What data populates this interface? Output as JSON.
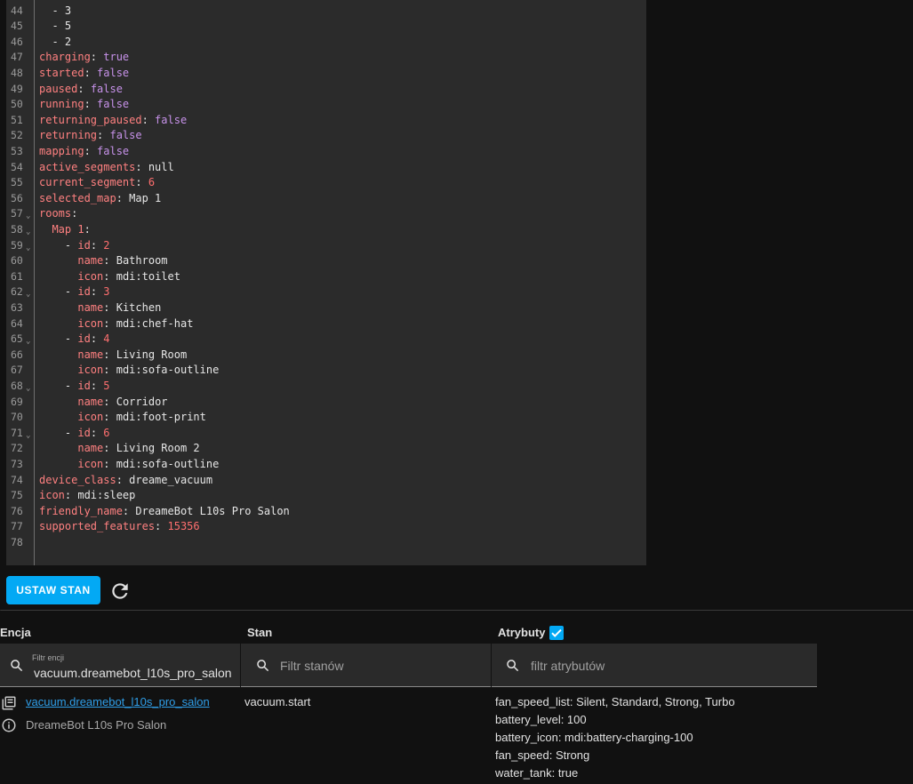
{
  "editor": {
    "lines": [
      {
        "n": "44",
        "fold": false,
        "indent": "  ",
        "parts": [
          {
            "t": "- ",
            "c": "p"
          },
          {
            "t": "3",
            "c": "s"
          }
        ]
      },
      {
        "n": "45",
        "fold": false,
        "indent": "  ",
        "parts": [
          {
            "t": "- ",
            "c": "p"
          },
          {
            "t": "5",
            "c": "s"
          }
        ]
      },
      {
        "n": "46",
        "fold": false,
        "indent": "  ",
        "parts": [
          {
            "t": "- ",
            "c": "p"
          },
          {
            "t": "2",
            "c": "s"
          }
        ]
      },
      {
        "n": "47",
        "fold": false,
        "indent": "",
        "parts": [
          {
            "t": "charging",
            "c": "k"
          },
          {
            "t": ": ",
            "c": "p"
          },
          {
            "t": "true",
            "c": "b"
          }
        ]
      },
      {
        "n": "48",
        "fold": false,
        "indent": "",
        "parts": [
          {
            "t": "started",
            "c": "k"
          },
          {
            "t": ": ",
            "c": "p"
          },
          {
            "t": "false",
            "c": "b"
          }
        ]
      },
      {
        "n": "49",
        "fold": false,
        "indent": "",
        "parts": [
          {
            "t": "paused",
            "c": "k"
          },
          {
            "t": ": ",
            "c": "p"
          },
          {
            "t": "false",
            "c": "b"
          }
        ]
      },
      {
        "n": "50",
        "fold": false,
        "indent": "",
        "parts": [
          {
            "t": "running",
            "c": "k"
          },
          {
            "t": ": ",
            "c": "p"
          },
          {
            "t": "false",
            "c": "b"
          }
        ]
      },
      {
        "n": "51",
        "fold": false,
        "indent": "",
        "parts": [
          {
            "t": "returning_paused",
            "c": "k"
          },
          {
            "t": ": ",
            "c": "p"
          },
          {
            "t": "false",
            "c": "b"
          }
        ]
      },
      {
        "n": "52",
        "fold": false,
        "indent": "",
        "parts": [
          {
            "t": "returning",
            "c": "k"
          },
          {
            "t": ": ",
            "c": "p"
          },
          {
            "t": "false",
            "c": "b"
          }
        ]
      },
      {
        "n": "53",
        "fold": false,
        "indent": "",
        "parts": [
          {
            "t": "mapping",
            "c": "k"
          },
          {
            "t": ": ",
            "c": "p"
          },
          {
            "t": "false",
            "c": "b"
          }
        ]
      },
      {
        "n": "54",
        "fold": false,
        "indent": "",
        "parts": [
          {
            "t": "active_segments",
            "c": "k"
          },
          {
            "t": ": ",
            "c": "p"
          },
          {
            "t": "null",
            "c": "s"
          }
        ]
      },
      {
        "n": "55",
        "fold": false,
        "indent": "",
        "parts": [
          {
            "t": "current_segment",
            "c": "k"
          },
          {
            "t": ": ",
            "c": "p"
          },
          {
            "t": "6",
            "c": "n"
          }
        ]
      },
      {
        "n": "56",
        "fold": false,
        "indent": "",
        "parts": [
          {
            "t": "selected_map",
            "c": "k"
          },
          {
            "t": ": ",
            "c": "p"
          },
          {
            "t": "Map 1",
            "c": "s"
          }
        ]
      },
      {
        "n": "57",
        "fold": true,
        "indent": "",
        "parts": [
          {
            "t": "rooms",
            "c": "k"
          },
          {
            "t": ":",
            "c": "p"
          }
        ]
      },
      {
        "n": "58",
        "fold": true,
        "indent": "  ",
        "parts": [
          {
            "t": "Map 1",
            "c": "k"
          },
          {
            "t": ":",
            "c": "p"
          }
        ]
      },
      {
        "n": "59",
        "fold": true,
        "indent": "    ",
        "parts": [
          {
            "t": "- ",
            "c": "p"
          },
          {
            "t": "id",
            "c": "k"
          },
          {
            "t": ": ",
            "c": "p"
          },
          {
            "t": "2",
            "c": "n"
          }
        ]
      },
      {
        "n": "60",
        "fold": false,
        "indent": "      ",
        "parts": [
          {
            "t": "name",
            "c": "k"
          },
          {
            "t": ": ",
            "c": "p"
          },
          {
            "t": "Bathroom",
            "c": "s"
          }
        ]
      },
      {
        "n": "61",
        "fold": false,
        "indent": "      ",
        "parts": [
          {
            "t": "icon",
            "c": "k"
          },
          {
            "t": ": ",
            "c": "p"
          },
          {
            "t": "mdi:toilet",
            "c": "s"
          }
        ]
      },
      {
        "n": "62",
        "fold": true,
        "indent": "    ",
        "parts": [
          {
            "t": "- ",
            "c": "p"
          },
          {
            "t": "id",
            "c": "k"
          },
          {
            "t": ": ",
            "c": "p"
          },
          {
            "t": "3",
            "c": "n"
          }
        ]
      },
      {
        "n": "63",
        "fold": false,
        "indent": "      ",
        "parts": [
          {
            "t": "name",
            "c": "k"
          },
          {
            "t": ": ",
            "c": "p"
          },
          {
            "t": "Kitchen",
            "c": "s"
          }
        ]
      },
      {
        "n": "64",
        "fold": false,
        "indent": "      ",
        "parts": [
          {
            "t": "icon",
            "c": "k"
          },
          {
            "t": ": ",
            "c": "p"
          },
          {
            "t": "mdi:chef-hat",
            "c": "s"
          }
        ]
      },
      {
        "n": "65",
        "fold": true,
        "indent": "    ",
        "parts": [
          {
            "t": "- ",
            "c": "p"
          },
          {
            "t": "id",
            "c": "k"
          },
          {
            "t": ": ",
            "c": "p"
          },
          {
            "t": "4",
            "c": "n"
          }
        ]
      },
      {
        "n": "66",
        "fold": false,
        "indent": "      ",
        "parts": [
          {
            "t": "name",
            "c": "k"
          },
          {
            "t": ": ",
            "c": "p"
          },
          {
            "t": "Living Room",
            "c": "s"
          }
        ]
      },
      {
        "n": "67",
        "fold": false,
        "indent": "      ",
        "parts": [
          {
            "t": "icon",
            "c": "k"
          },
          {
            "t": ": ",
            "c": "p"
          },
          {
            "t": "mdi:sofa-outline",
            "c": "s"
          }
        ]
      },
      {
        "n": "68",
        "fold": true,
        "indent": "    ",
        "parts": [
          {
            "t": "- ",
            "c": "p"
          },
          {
            "t": "id",
            "c": "k"
          },
          {
            "t": ": ",
            "c": "p"
          },
          {
            "t": "5",
            "c": "n"
          }
        ]
      },
      {
        "n": "69",
        "fold": false,
        "indent": "      ",
        "parts": [
          {
            "t": "name",
            "c": "k"
          },
          {
            "t": ": ",
            "c": "p"
          },
          {
            "t": "Corridor",
            "c": "s"
          }
        ]
      },
      {
        "n": "70",
        "fold": false,
        "indent": "      ",
        "parts": [
          {
            "t": "icon",
            "c": "k"
          },
          {
            "t": ": ",
            "c": "p"
          },
          {
            "t": "mdi:foot-print",
            "c": "s"
          }
        ]
      },
      {
        "n": "71",
        "fold": true,
        "indent": "    ",
        "parts": [
          {
            "t": "- ",
            "c": "p"
          },
          {
            "t": "id",
            "c": "k"
          },
          {
            "t": ": ",
            "c": "p"
          },
          {
            "t": "6",
            "c": "n"
          }
        ]
      },
      {
        "n": "72",
        "fold": false,
        "indent": "      ",
        "parts": [
          {
            "t": "name",
            "c": "k"
          },
          {
            "t": ": ",
            "c": "p"
          },
          {
            "t": "Living Room 2",
            "c": "s"
          }
        ]
      },
      {
        "n": "73",
        "fold": false,
        "indent": "      ",
        "parts": [
          {
            "t": "icon",
            "c": "k"
          },
          {
            "t": ": ",
            "c": "p"
          },
          {
            "t": "mdi:sofa-outline",
            "c": "s"
          }
        ]
      },
      {
        "n": "74",
        "fold": false,
        "indent": "",
        "parts": [
          {
            "t": "device_class",
            "c": "k"
          },
          {
            "t": ": ",
            "c": "p"
          },
          {
            "t": "dreame_vacuum",
            "c": "s"
          }
        ]
      },
      {
        "n": "75",
        "fold": false,
        "indent": "",
        "parts": [
          {
            "t": "icon",
            "c": "k"
          },
          {
            "t": ": ",
            "c": "p"
          },
          {
            "t": "mdi:sleep",
            "c": "s"
          }
        ]
      },
      {
        "n": "76",
        "fold": false,
        "indent": "",
        "parts": [
          {
            "t": "friendly_name",
            "c": "k"
          },
          {
            "t": ": ",
            "c": "p"
          },
          {
            "t": "DreameBot L10s Pro Salon",
            "c": "s"
          }
        ]
      },
      {
        "n": "77",
        "fold": false,
        "indent": "",
        "parts": [
          {
            "t": "supported_features",
            "c": "k"
          },
          {
            "t": ": ",
            "c": "p"
          },
          {
            "t": "15356",
            "c": "n"
          }
        ]
      },
      {
        "n": "78",
        "fold": false,
        "indent": "",
        "parts": []
      }
    ]
  },
  "actions": {
    "set_state_label": "USTAW STAN",
    "refresh_icon": "refresh-icon"
  },
  "columns": {
    "entity": "Encja",
    "state": "Stan",
    "attributes": "Atrybuty",
    "attributes_checked": true
  },
  "filters": {
    "entity_label": "Filtr encji",
    "entity_value": "vacuum.dreamebot_l10s_pro_salon",
    "state_placeholder": "Filtr stanów",
    "attr_placeholder": "filtr atrybutów"
  },
  "result": {
    "entity_id": "vacuum.dreamebot_l10s_pro_salon",
    "friendly_name": "DreameBot L10s Pro Salon",
    "state": "vacuum.start",
    "attributes": [
      "fan_speed_list: Silent, Standard, Strong, Turbo",
      "battery_level: 100",
      "battery_icon: mdi:battery-charging-100",
      "fan_speed: Strong",
      "water_tank: true"
    ]
  },
  "colors": {
    "accent": "#03a9f4",
    "key": "#ff8080",
    "bool": "#c792ea",
    "number": "#ff6f6f",
    "link": "#2f9ee8"
  }
}
